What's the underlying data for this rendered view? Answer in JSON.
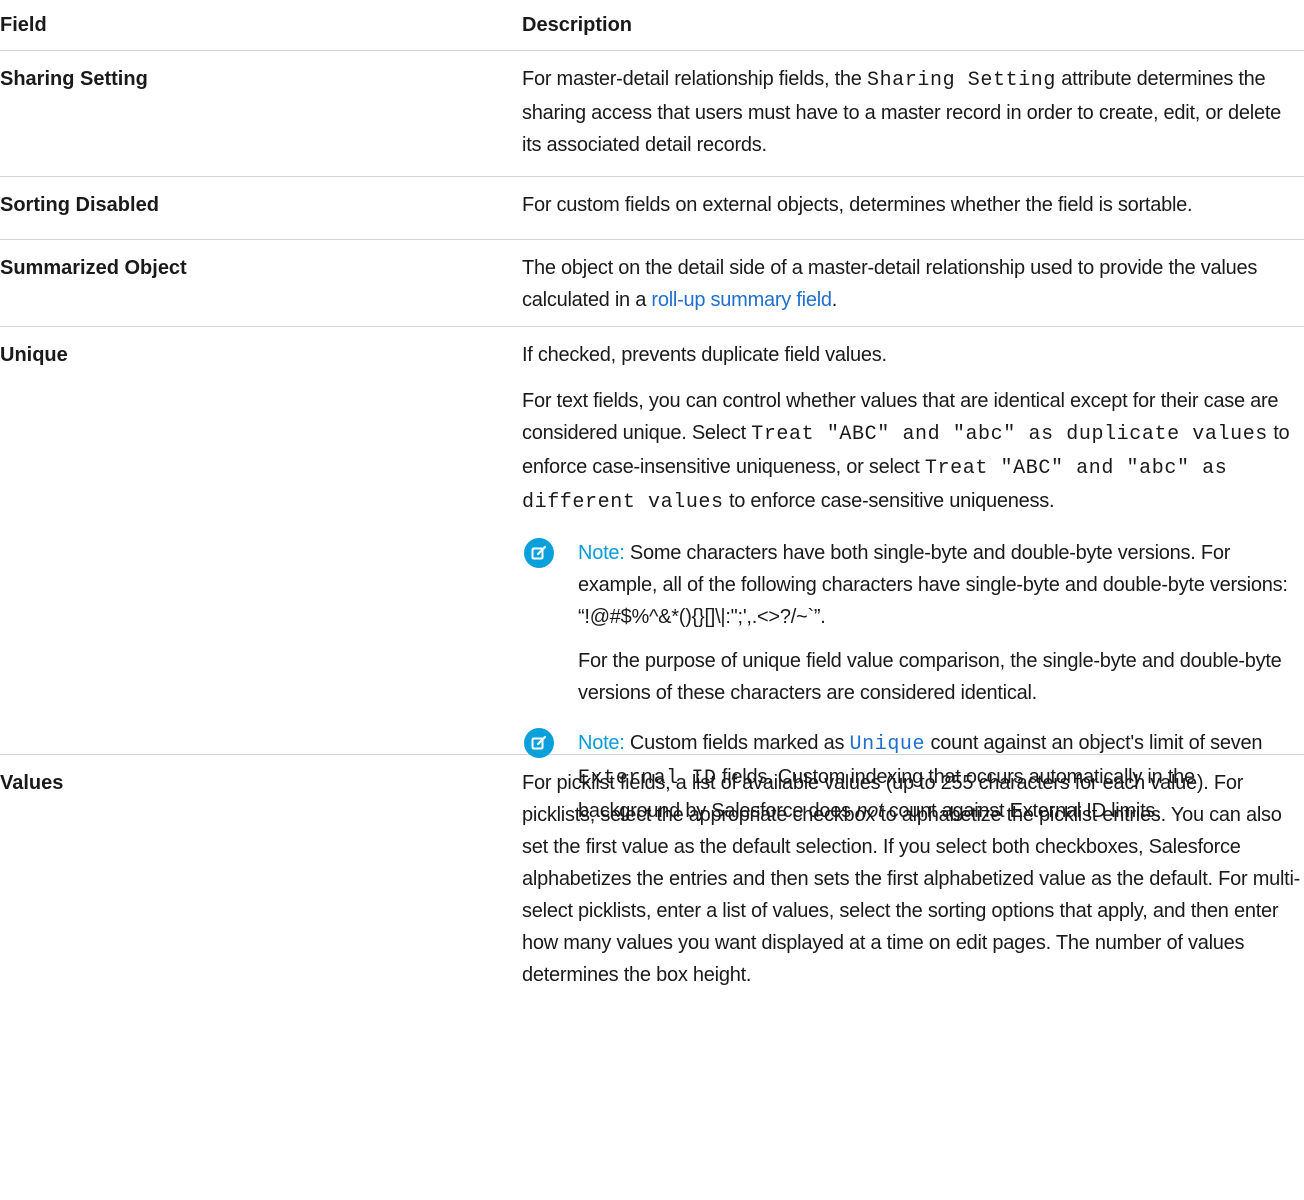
{
  "header": {
    "field": "Field",
    "description": "Description"
  },
  "rows": [
    {
      "field": "Sharing Setting",
      "d1_pre": "For master-detail relationship fields, the ",
      "d1_code": "Sharing Setting",
      "d1_post": " attribute determines the sharing access that users must have to a master record in order to create, edit, or delete its associated detail records."
    },
    {
      "field": "Sorting Disabled",
      "d1": "For custom fields on external objects, determines whether the field is sortable."
    },
    {
      "field": "Summarized Object",
      "d1_pre": "The object on the detail side of a master-detail relationship used to provide the values calculated in a ",
      "d1_link": "roll-up summary field",
      "d1_post": "."
    },
    {
      "field": "Unique",
      "p1": "If checked, prevents duplicate field values.",
      "p2_a": "For text fields, you can control whether values that are identical except for their case are considered unique. Select ",
      "p2_code1": "Treat \"ABC\" and \"abc\" as duplicate values",
      "p2_b": " to enforce case-insensitive uniqueness, or select ",
      "p2_code2": "Treat \"ABC\" and \"abc\" as different values",
      "p2_c": " to enforce case-sensitive uniqueness.",
      "note_label": "Note:",
      "note1_p1": "Some characters have both single-byte and double-byte versions. For example, all of the following characters have single-byte and double-byte versions: “!@#$%^&*(){}[]\\|:\";',.<>?/~`”.",
      "note1_p2": "For the purpose of unique field value comparison, the single-byte and double-byte versions of these characters are considered identical.",
      "note2_a": "Custom fields marked as ",
      "note2_code1": "Unique",
      "note2_b": " count against an object's limit of seven ",
      "note2_code2": "External ID",
      "note2_c": " fields. Custom indexing that occurs automatically in the background by Salesforce does ",
      "note2_em": "not",
      "note2_d": " count against External ID limits."
    },
    {
      "field": "Values",
      "d1": "For picklist fields, a list of available values (up to 255 characters for each value). For picklists, select the appropriate checkbox to alphabetize the picklist entries. You can also set the first value as the default selection. If you select both checkboxes, Salesforce alphabetizes the entries and then sets the first alphabetized value as the default. For multi-select picklists, enter a list of values, select the sorting options that apply, and then enter how many values you want displayed at a time on edit pages. The number of values determines the box height."
    }
  ],
  "colors": {
    "link": "#1f6fd1",
    "note_icon": "#0aa0dc",
    "note_label": "#0a9ad8",
    "rule": "#d4d4d4"
  },
  "icons": {
    "note": "edit-note-icon"
  }
}
